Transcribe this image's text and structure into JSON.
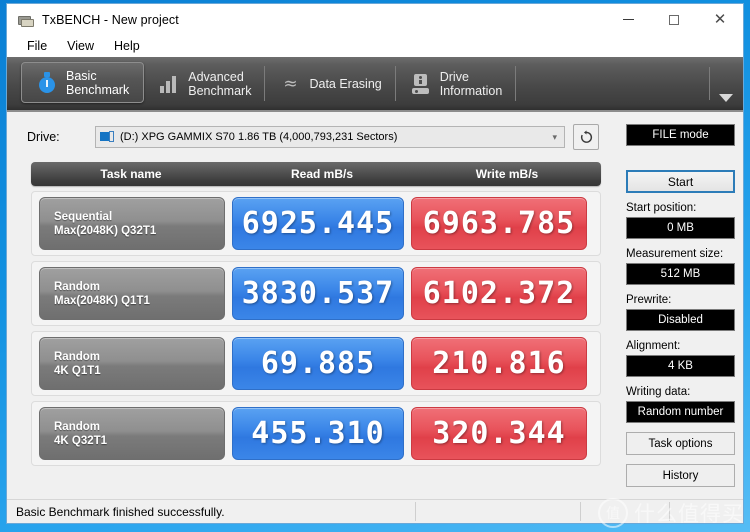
{
  "window": {
    "title": "TxBENCH - New project",
    "icon": "plug-icon",
    "controls": {
      "minimize": "–",
      "maximize": "□",
      "close": "✕"
    }
  },
  "menubar": {
    "items": [
      "File",
      "View",
      "Help"
    ]
  },
  "tabs": [
    {
      "label": "Basic\nBenchmark",
      "icon": "stopwatch-icon",
      "active": true
    },
    {
      "label": "Advanced\nBenchmark",
      "icon": "bar-chart-icon",
      "active": false
    },
    {
      "label": "Data Erasing",
      "icon": "zigzag-icon",
      "active": false
    },
    {
      "label": "Drive\nInformation",
      "icon": "hard-drive-icon",
      "active": false
    }
  ],
  "tabs_overflow_icon": "chevron-down-icon",
  "drive": {
    "label": "Drive:",
    "value": "(D:) XPG GAMMIX S70  1.86 TB (4,000,793,231 Sectors)",
    "icon": "drive-icon",
    "dropdown_icon": "chevron-down-icon",
    "refresh_icon": "refresh-icon"
  },
  "table": {
    "headers": [
      "Task name",
      "Read mB/s",
      "Write mB/s"
    ],
    "rows": [
      {
        "task": "Sequential\nMax(2048K) Q32T1",
        "read": "6925.445",
        "write": "6963.785"
      },
      {
        "task": "Random\nMax(2048K) Q1T1",
        "read": "3830.537",
        "write": "6102.372"
      },
      {
        "task": "Random\n4K Q1T1",
        "read": "69.885",
        "write": "210.816"
      },
      {
        "task": "Random\n4K Q32T1",
        "read": "455.310",
        "write": "320.344"
      }
    ]
  },
  "panel": {
    "mode_button": "FILE mode",
    "start_button": "Start",
    "start_position_label": "Start position:",
    "start_position_value": "0 MB",
    "measurement_size_label": "Measurement size:",
    "measurement_size_value": "512 MB",
    "prewrite_label": "Prewrite:",
    "prewrite_value": "Disabled",
    "alignment_label": "Alignment:",
    "alignment_value": "4 KB",
    "writing_data_label": "Writing data:",
    "writing_data_value": "Random number",
    "task_options_button": "Task options",
    "history_button": "History"
  },
  "statusbar": {
    "message": "Basic Benchmark finished successfully."
  },
  "watermark": {
    "logo": "值",
    "text": "什么值得买"
  },
  "colors": {
    "read_blue": "#3b86e8",
    "write_red": "#e8535b",
    "task_gray": "#8f8f8f",
    "accent_blue": "#2c7cb8",
    "desktop_blue": "#1190e0"
  }
}
